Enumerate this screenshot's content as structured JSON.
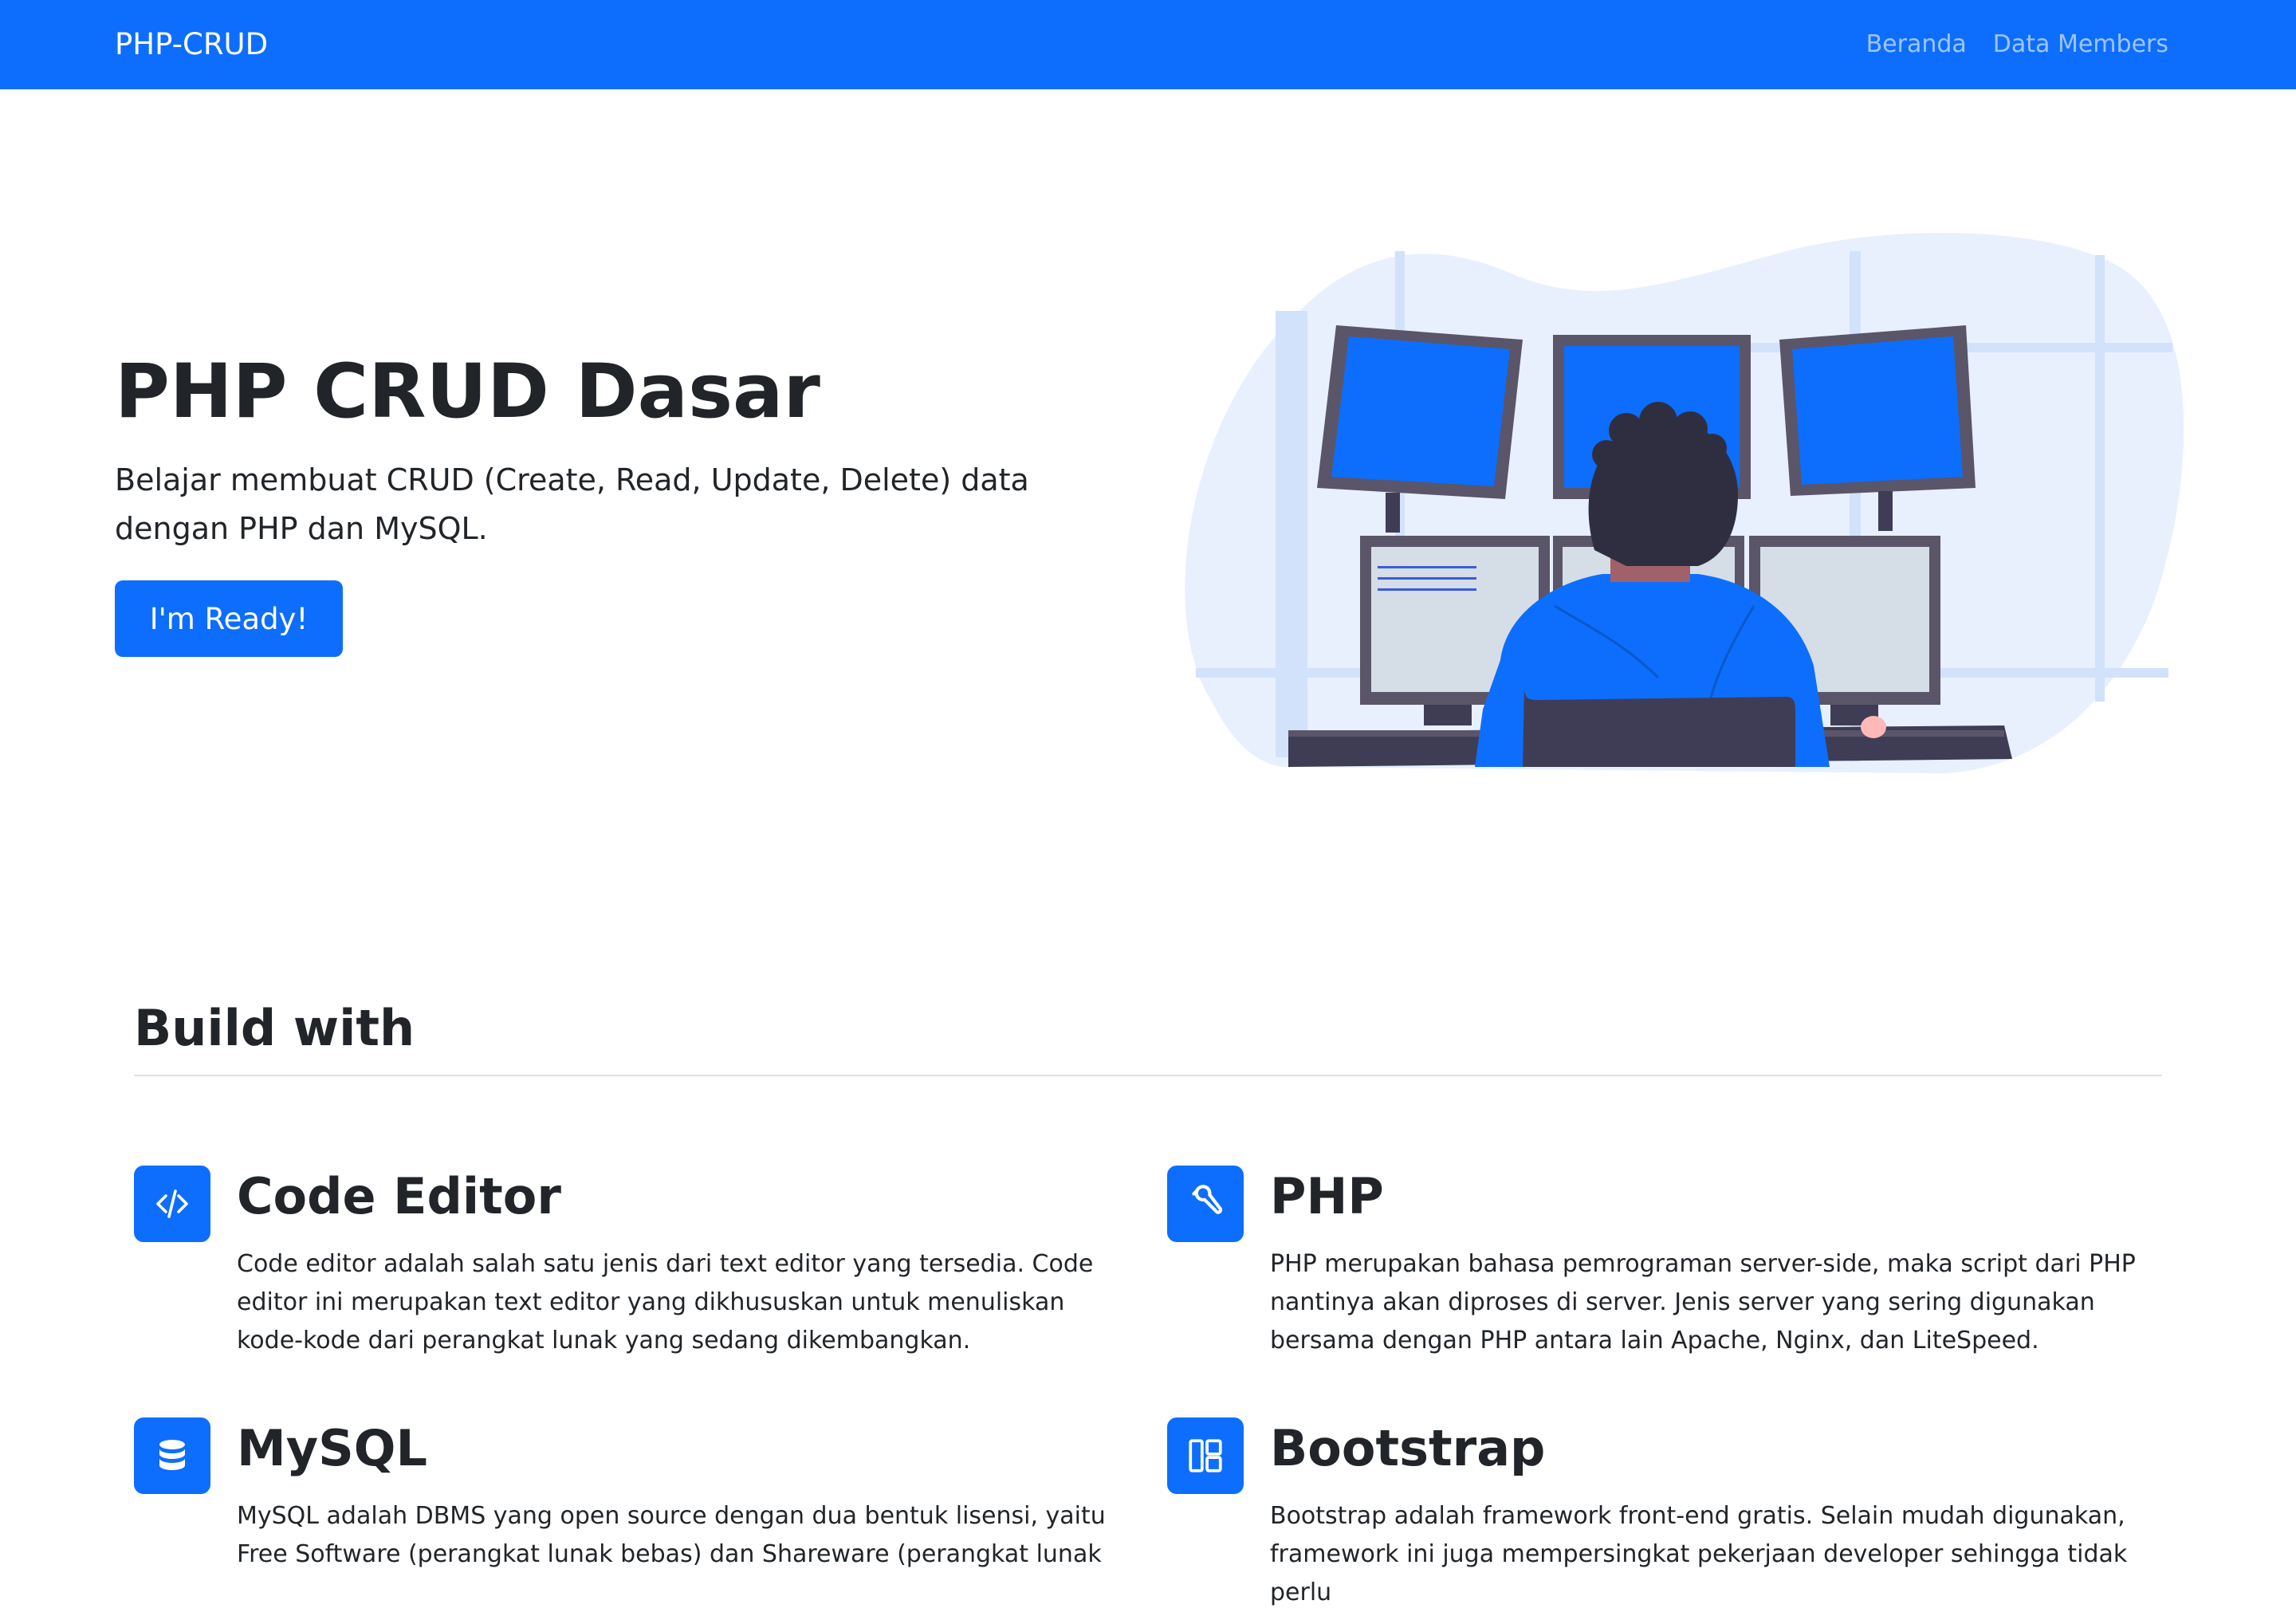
{
  "navbar": {
    "brand": "PHP-CRUD",
    "links": [
      "Beranda",
      "Data Members"
    ],
    "color": "#0d6efd"
  },
  "hero": {
    "title": "PHP CRUD Dasar",
    "lead": "Belajar membuat CRUD (Create, Read, Update, Delete) data dengan PHP dan MySQL.",
    "button_label": "I'm Ready!",
    "illustration": "person-at-multi-monitor-workstation"
  },
  "build": {
    "title": "Build with",
    "features": [
      {
        "icon": "code-icon",
        "title": "Code Editor",
        "text": "Code editor adalah salah satu jenis dari text editor yang tersedia. Code editor ini merupakan text editor yang dikhususkan untuk menuliskan kode-kode dari perangkat lunak yang sedang dikembangkan."
      },
      {
        "icon": "wrench-icon",
        "title": "PHP",
        "text": "PHP merupakan bahasa pemrograman server-side, maka script dari PHP nantinya akan diproses di server. Jenis server yang sering digunakan bersama dengan PHP antara lain Apache, Nginx, dan LiteSpeed."
      },
      {
        "icon": "database-icon",
        "title": "MySQL",
        "text": "MySQL adalah DBMS yang open source dengan dua bentuk lisensi, yaitu Free Software (perangkat lunak bebas) dan Shareware (perangkat lunak"
      },
      {
        "icon": "layout-icon",
        "title": "Bootstrap",
        "text": "Bootstrap adalah framework front-end gratis. Selain mudah digunakan, framework ini juga mempersingkat pekerjaan developer sehingga tidak perlu"
      }
    ]
  }
}
